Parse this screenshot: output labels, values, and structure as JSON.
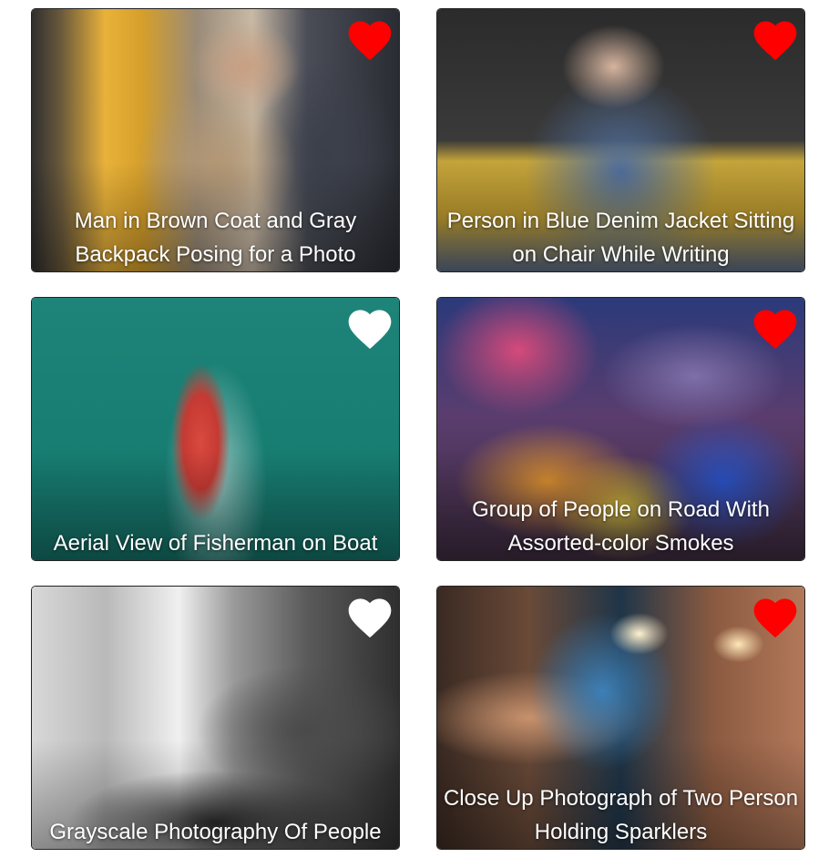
{
  "colors": {
    "heart_liked": "#ff0000",
    "heart_unliked": "#ffffff",
    "caption_text": "#ffffff"
  },
  "cards": [
    {
      "caption": "Man in Brown Coat and Gray Backpack Posing for a Photo",
      "liked": true
    },
    {
      "caption": "Person in Blue Denim Jacket Sitting on Chair While Writing",
      "liked": true
    },
    {
      "caption": "Aerial View of Fisherman on Boat",
      "liked": false
    },
    {
      "caption": "Group of People on Road With Assorted-color Smokes",
      "liked": true
    },
    {
      "caption": "Grayscale Photography Of People",
      "liked": false
    },
    {
      "caption": "Close Up Photograph of Two Person Holding Sparklers",
      "liked": true
    }
  ]
}
